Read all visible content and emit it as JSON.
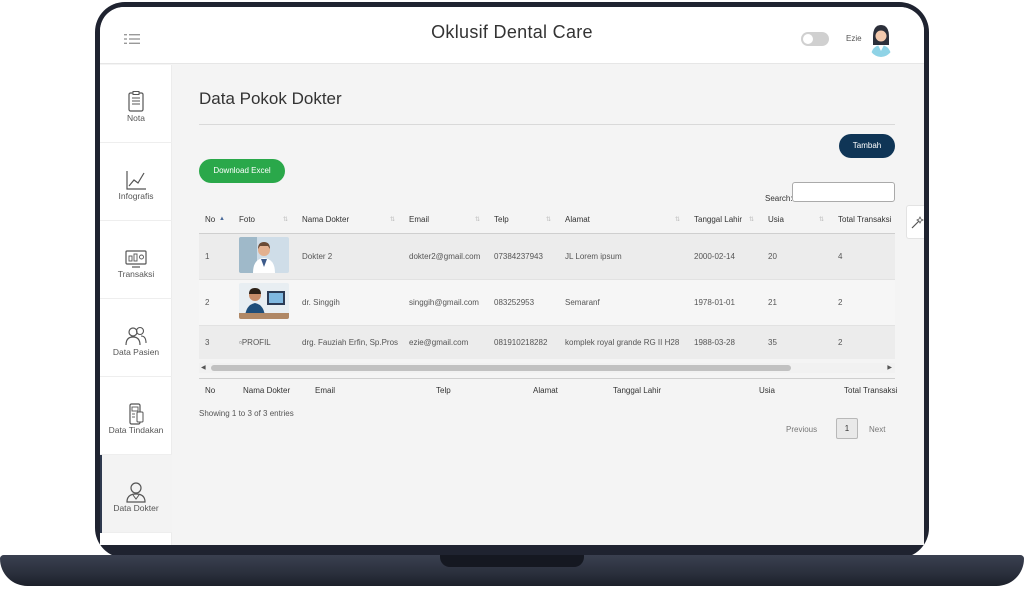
{
  "header": {
    "title": "Oklusif Dental Care",
    "user_name": "Ezie"
  },
  "sidebar": {
    "items": [
      {
        "label": "Nota",
        "icon": "receipt-icon"
      },
      {
        "label": "Infografis",
        "icon": "chart-line-icon"
      },
      {
        "label": "Transaksi",
        "icon": "monitor-icon"
      },
      {
        "label": "Data Pasien",
        "icon": "users-icon"
      },
      {
        "label": "Data Tindakan",
        "icon": "device-icon"
      },
      {
        "label": "Data Dokter",
        "icon": "doctor-icon"
      }
    ],
    "active": "Data Dokter"
  },
  "page": {
    "title": "Data Pokok Dokter",
    "add_button": "Tambah",
    "export_button": "Download Excel",
    "search_label": "Search:",
    "search_value": ""
  },
  "table": {
    "columns": [
      "No",
      "Foto",
      "Nama Dokter",
      "Email",
      "Telp",
      "Alamat",
      "Tanggal Lahir",
      "Usia",
      "Total Transaksi"
    ],
    "rows": [
      {
        "no": "1",
        "foto": "photo",
        "nama": "Dokter 2",
        "email": "dokter2@gmail.com",
        "telp": "07384237943",
        "alamat": "JL Lorem ipsum",
        "tgl": "2000-02-14",
        "usia": "20",
        "total": "4"
      },
      {
        "no": "2",
        "foto": "photo",
        "nama": "dr. Singgih",
        "email": "singgih@gmail.com",
        "telp": "083252953",
        "alamat": "Semaranf",
        "tgl": "1978-01-01",
        "usia": "21",
        "total": "2"
      },
      {
        "no": "3",
        "foto": "PROFIL",
        "nama": "drg. Fauziah Erfin, Sp.Pros",
        "email": "ezie@gmail.com",
        "telp": "081910218282",
        "alamat": "komplek royal grande RG II H28",
        "tgl": "1988-03-28",
        "usia": "35",
        "total": "2"
      }
    ],
    "footer_columns": [
      "No",
      "Nama Dokter",
      "Email",
      "Telp",
      "Alamat",
      "Tanggal Lahir",
      "Usia",
      "Total Transaksi"
    ],
    "info": "Showing 1 to 3 of 3 entries"
  },
  "pagination": {
    "previous": "Previous",
    "current": "1",
    "next": "Next"
  },
  "colors": {
    "primary_button": "#0f3556",
    "excel_button": "#2aa84a",
    "frame": "#1f2330"
  }
}
